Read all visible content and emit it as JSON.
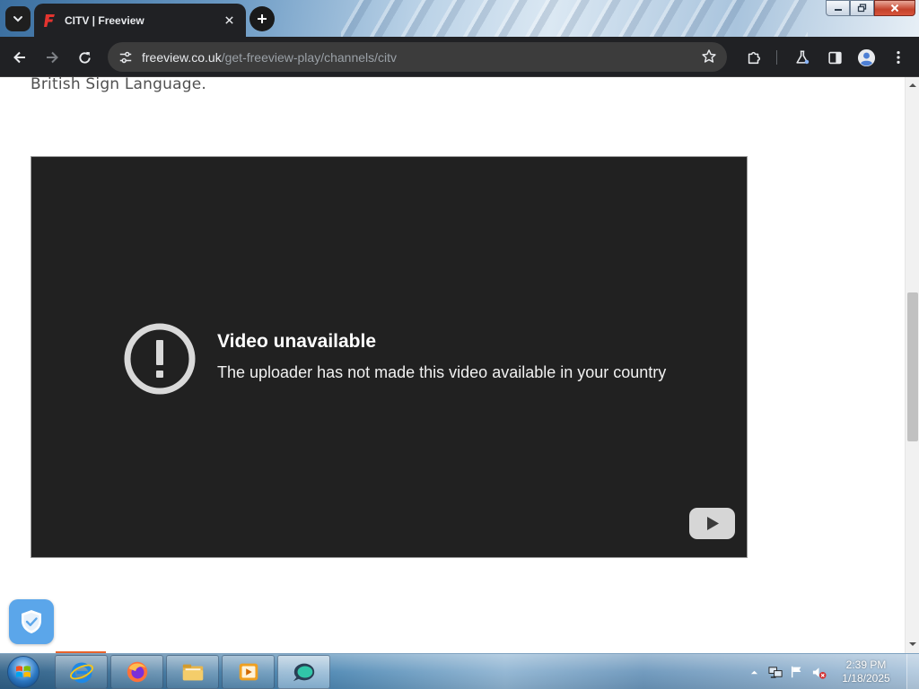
{
  "browser": {
    "tab": {
      "title": "CITV | Freeview",
      "favicon": "freeview-f-icon"
    },
    "url": {
      "host": "freeview.co.uk",
      "path": "/get-freeview-play/channels/citv"
    },
    "colors": {
      "chrome_dark": "#202124",
      "omnibox": "#3c3c3c",
      "favicon_red": "#e3342f"
    }
  },
  "page": {
    "intro_text": "British Sign Language.",
    "video": {
      "title": "Video unavailable",
      "message": "The uploader has not made this video available in your country",
      "background": "#212121"
    },
    "shield_color": "#5ba6ea"
  },
  "taskbar": {
    "items": [
      "internet-explorer-icon",
      "firefox-icon",
      "file-explorer-icon",
      "media-player-icon",
      "app-icon"
    ],
    "clock": {
      "time": "2:39 PM",
      "date": "1/18/2025"
    }
  }
}
